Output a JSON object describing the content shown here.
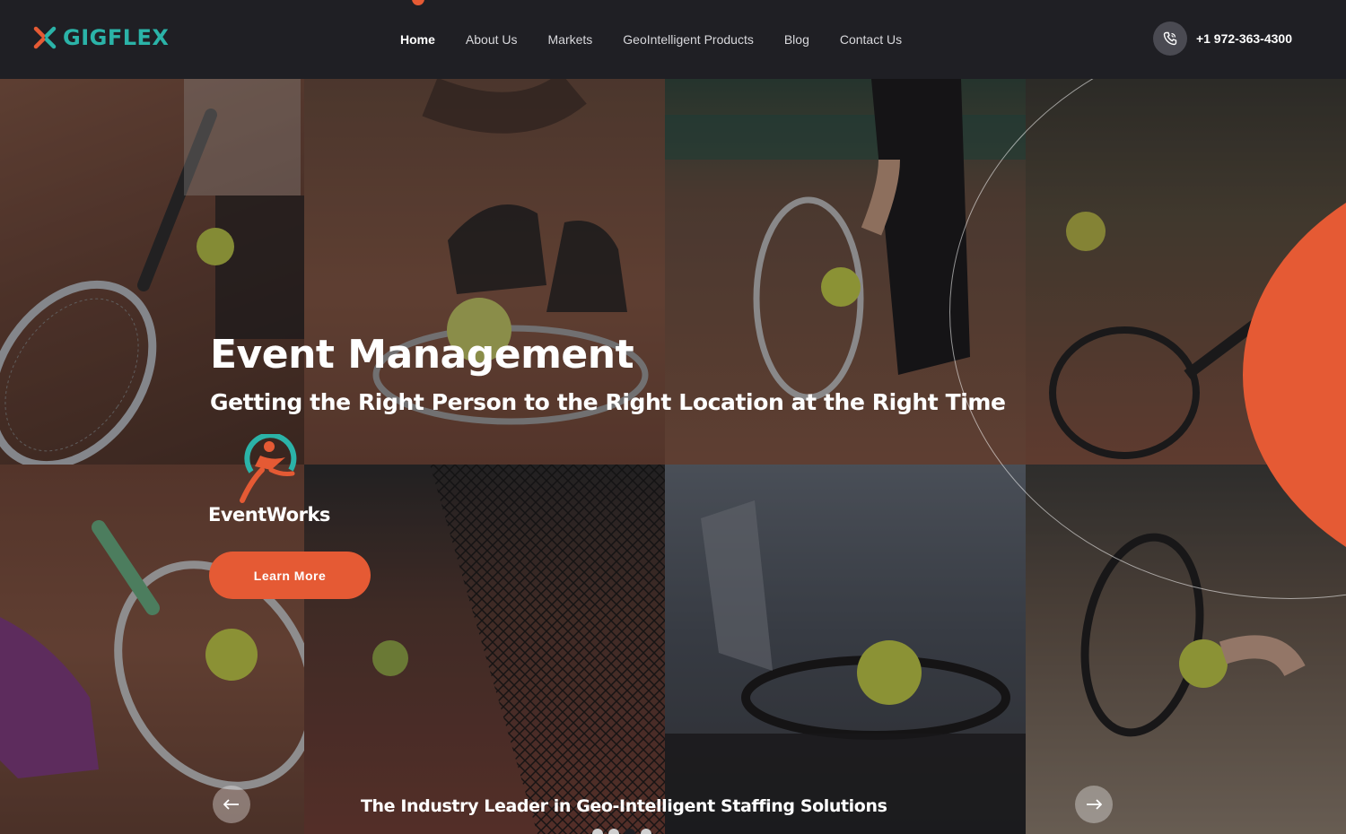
{
  "header": {
    "brand": "GIGFLEX",
    "nav": [
      {
        "label": "Home",
        "active": true
      },
      {
        "label": "About Us"
      },
      {
        "label": "Markets"
      },
      {
        "label": "GeoIntelligent Products"
      },
      {
        "label": "Blog"
      },
      {
        "label": "Contact Us"
      }
    ],
    "phone": "+1 972-363-4300"
  },
  "hero": {
    "title": "Event Management",
    "subtitle": "Getting the Right Person to the Right Location at the Right Time",
    "partner_name": "EventWorks",
    "cta_label": "Learn More",
    "tagline": "The Industry Leader in Geo-Intelligent Staffing Solutions"
  },
  "colors": {
    "accent": "#e55a34",
    "brand_teal": "#2bb3a8",
    "header_bg": "#1f1f24"
  },
  "slider": {
    "slide_count": 4,
    "active_slide": 3
  },
  "icons": [
    "phone-icon",
    "arrow-left-icon",
    "arrow-right-icon"
  ]
}
